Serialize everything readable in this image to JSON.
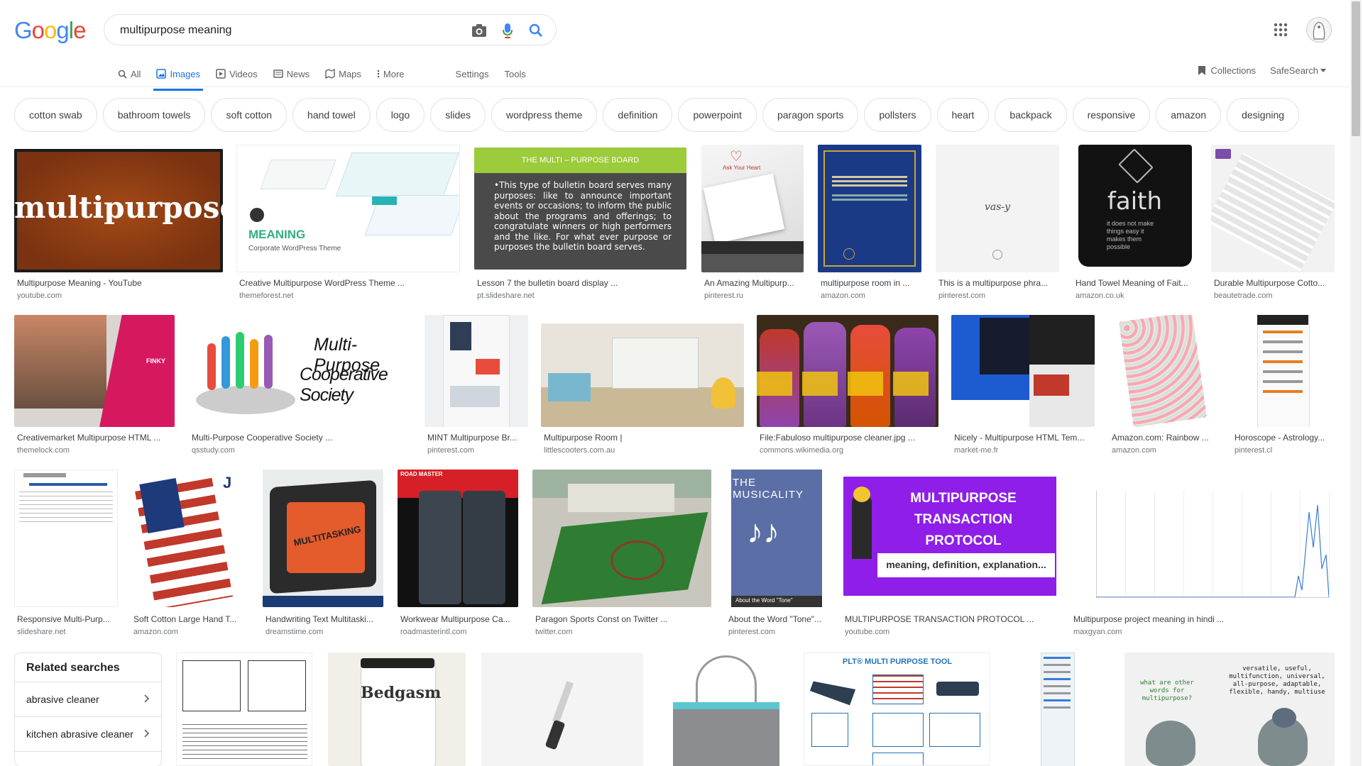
{
  "logo": {
    "letters": [
      "G",
      "o",
      "o",
      "g",
      "l",
      "e"
    ]
  },
  "search": {
    "query": "multipurpose meaning"
  },
  "tabs": [
    {
      "label": "All",
      "icon": "search-icon"
    },
    {
      "label": "Images",
      "icon": "image-icon",
      "active": true
    },
    {
      "label": "Videos",
      "icon": "video-icon"
    },
    {
      "label": "News",
      "icon": "news-icon"
    },
    {
      "label": "Maps",
      "icon": "map-icon"
    },
    {
      "label": "More",
      "icon": "more-vert-icon"
    }
  ],
  "tools": {
    "settings": "Settings",
    "tools": "Tools",
    "collections": "Collections",
    "safesearch": "SafeSearch"
  },
  "chips": [
    "cotton swab",
    "bathroom towels",
    "soft cotton",
    "hand towel",
    "logo",
    "slides",
    "wordpress theme",
    "definition",
    "powerpoint",
    "paragon sports",
    "pollsters",
    "heart",
    "backpack",
    "responsive",
    "amazon",
    "designing"
  ],
  "results": [
    {
      "title": "Multipurpose Meaning - YouTube",
      "source": "youtube.com",
      "thumb_text": "multipurpose"
    },
    {
      "title": "Creative Multipurpose WordPress Theme ...",
      "source": "themeforest.net",
      "thumb_text": "MEANING",
      "thumb_sub": "Corporate WordPress Theme"
    },
    {
      "title": "Lesson 7 the bulletin board display ...",
      "source": "pt.slideshare.net",
      "thumb_text": "THE MULTI – PURPOSE BOARD",
      "thumb_sub": "•This type of bulletin board serves many purposes: like to announce important events or occasions; to inform the public about the programs and offerings; to congratulate winners or high performers and the like. For what ever purpose or purposes the bulletin board serves."
    },
    {
      "title": "An Amazing Multipurp...",
      "source": "pinterest.ru",
      "thumb_text": "Ask Your Heart"
    },
    {
      "title": "multipurpose room in ...",
      "source": "amazon.com"
    },
    {
      "title": "This is a multipurpose phra...",
      "source": "pinterest.com",
      "thumb_text": "vas-y"
    },
    {
      "title": "Hand Towel Meaning of Fait...",
      "source": "amazon.co.uk",
      "thumb_text": "faith",
      "thumb_sub": "it does not make things easy it makes them possible"
    },
    {
      "title": "Durable Multipurpose Cotto...",
      "source": "beautetrade.com"
    },
    {
      "title": "Creativemarket Multipurpose HTML ...",
      "source": "themelock.com",
      "thumb_text": "FINKY"
    },
    {
      "title": "Multi-Purpose Cooperative Society ...",
      "source": "qsstudy.com",
      "thumb_text": "Multi-Purpose",
      "thumb_sub": "Cooperative Society"
    },
    {
      "title": "MINT Multipurpose Br...",
      "source": "pinterest.com"
    },
    {
      "title": "Multipurpose Room |",
      "source": "littlescooters.com.au"
    },
    {
      "title": "File:Fabuloso multipurpose cleaner.jpg ...",
      "source": "commons.wikimedia.org"
    },
    {
      "title": "Nicely - Multipurpose HTML Tem...",
      "source": "market-me.fr"
    },
    {
      "title": "Amazon.com: Rainbow ...",
      "source": "amazon.com"
    },
    {
      "title": "Horoscope - Astrology...",
      "source": "pinterest.cl"
    },
    {
      "title": "Responsive Multi-Purp...",
      "source": "slideshare.net"
    },
    {
      "title": "Soft Cotton Large Hand T...",
      "source": "amazon.com"
    },
    {
      "title": "Handwriting Text Multitaski...",
      "source": "dreamstime.com",
      "thumb_text": "MULTITASKING"
    },
    {
      "title": "Workwear Multipurpose Ca...",
      "source": "roadmasterintl.com",
      "thumb_text": "ROAD MASTER"
    },
    {
      "title": "Paragon Sports Const on Twitter ...",
      "source": "twitter.com"
    },
    {
      "title": "About the Word \"Tone\"...",
      "source": "pinterest.com",
      "thumb_text": "THE MUSICALITY",
      "thumb_sub": "About the Word \"Tone\""
    },
    {
      "title": "MULTIPURPOSE TRANSACTION PROTOCOL ...",
      "source": "youtube.com",
      "thumb_text": "MULTIPURPOSE TRANSACTION PROTOCOL",
      "thumb_sub": "meaning, definition, explanation..."
    },
    {
      "title": "Multipurpose project meaning in hindi ...",
      "source": "maxgyan.com"
    }
  ],
  "bottom_thumbs": {
    "bedgasm": "Bedgasm",
    "plt": "PLT® MULTI PURPOSE TOOL",
    "pigeon_q": "what are other words for multipurpose?",
    "pigeon_a": "versatile, useful, multifunction, universal, all-purpose, adaptable, flexible, handy, multiuse"
  },
  "related": {
    "heading": "Related searches",
    "items": [
      "abrasive cleaner",
      "kitchen abrasive cleaner"
    ]
  },
  "colors": {
    "accent": "#1a73e8",
    "g_blue": "#4285f4",
    "g_red": "#ea4335",
    "g_yellow": "#fbbc05",
    "g_green": "#34a853"
  }
}
